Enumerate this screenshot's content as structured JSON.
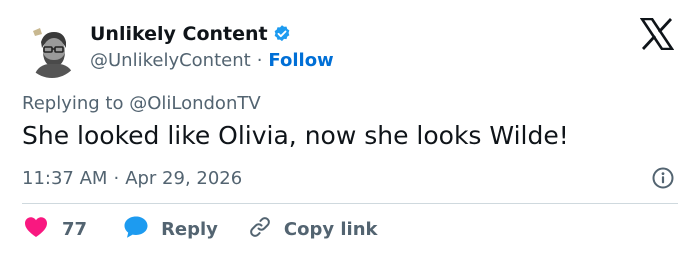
{
  "author": {
    "display_name": "Unlikely Content",
    "handle": "@UnlikelyContent",
    "separator": "·",
    "follow_label": "Follow",
    "verified": true
  },
  "reply_context": {
    "text": "Replying to @OliLondonTV"
  },
  "tweet": {
    "text": "She looked like Olivia, now she looks Wilde!",
    "time": "11:37 AM",
    "separator": "·",
    "date": "Apr 29, 2026"
  },
  "actions": {
    "like_count": "77",
    "reply_label": "Reply",
    "copy_link_label": "Copy link"
  },
  "icons": {
    "brand": "x-logo-icon",
    "verified": "verified-badge-icon",
    "info": "info-icon",
    "like": "heart-icon",
    "reply": "speech-bubble-icon",
    "copy": "link-icon"
  },
  "colors": {
    "text_primary": "#0f1419",
    "text_secondary": "#536471",
    "link_blue": "#006fd6",
    "verified_blue": "#1d9bf0",
    "heart_red": "#f91880",
    "divider": "#cfd9de"
  }
}
